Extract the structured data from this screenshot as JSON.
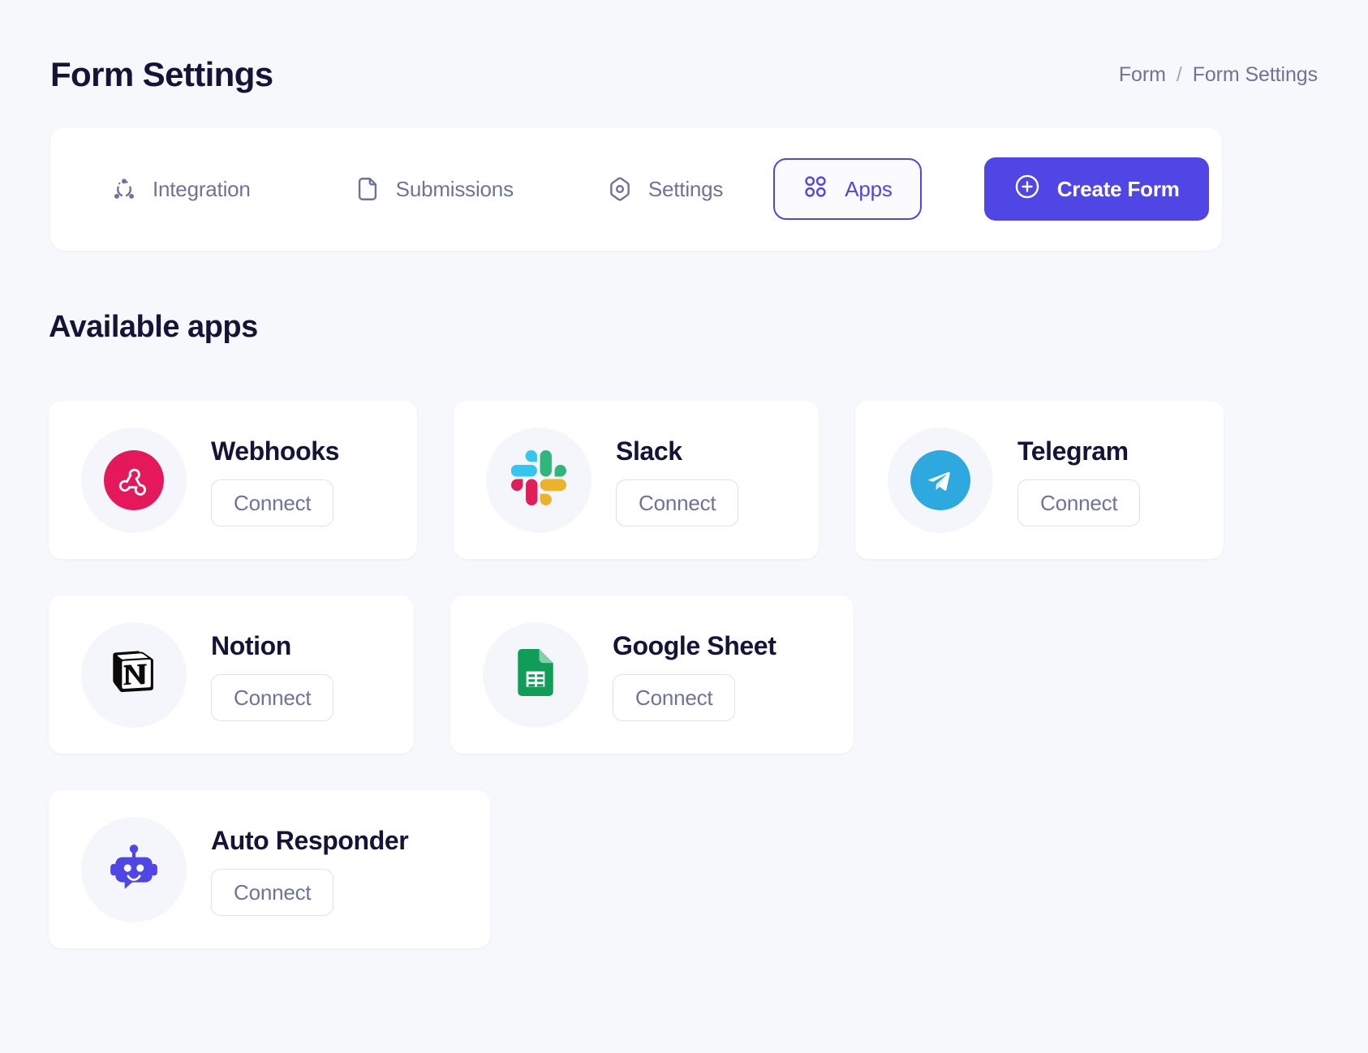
{
  "header": {
    "title": "Form Settings",
    "breadcrumb": {
      "parent": "Form",
      "separator": "/",
      "current": "Form Settings"
    }
  },
  "toolbar": {
    "items": [
      {
        "label": "Integration",
        "icon": "integration-icon"
      },
      {
        "label": "Submissions",
        "icon": "document-icon"
      },
      {
        "label": "Settings",
        "icon": "settings-hexagon-icon"
      }
    ],
    "apps_button": {
      "label": "Apps",
      "icon": "grid-apps-icon",
      "accent": "#4F46E5"
    },
    "create_button": {
      "label": "Create Form",
      "icon": "plus-circle-icon",
      "background": "#4F46E5"
    }
  },
  "section": {
    "title": "Available apps"
  },
  "apps": [
    {
      "name": "Webhooks",
      "icon": "webhooks-icon",
      "action": "Connect",
      "brand_color": "#E5185C"
    },
    {
      "name": "Slack",
      "icon": "slack-icon",
      "action": "Connect",
      "brand_color": "#36C5F0"
    },
    {
      "name": "Telegram",
      "icon": "telegram-icon",
      "action": "Connect",
      "brand_color": "#2DA9E0"
    },
    {
      "name": "Notion",
      "icon": "notion-icon",
      "action": "Connect",
      "brand_color": "#000000"
    },
    {
      "name": "Google Sheet",
      "icon": "google-sheet-icon",
      "action": "Connect",
      "brand_color": "#0F9D58"
    },
    {
      "name": "Auto Responder",
      "icon": "robot-icon",
      "action": "Connect",
      "brand_color": "#4F46E5"
    }
  ],
  "colors": {
    "page_background": "#F7F8FC",
    "card_background": "#FFFFFF",
    "text_primary": "#141437",
    "text_muted": "#6F7394",
    "accent": "#4F46E5",
    "border": "#DEE1F0"
  }
}
